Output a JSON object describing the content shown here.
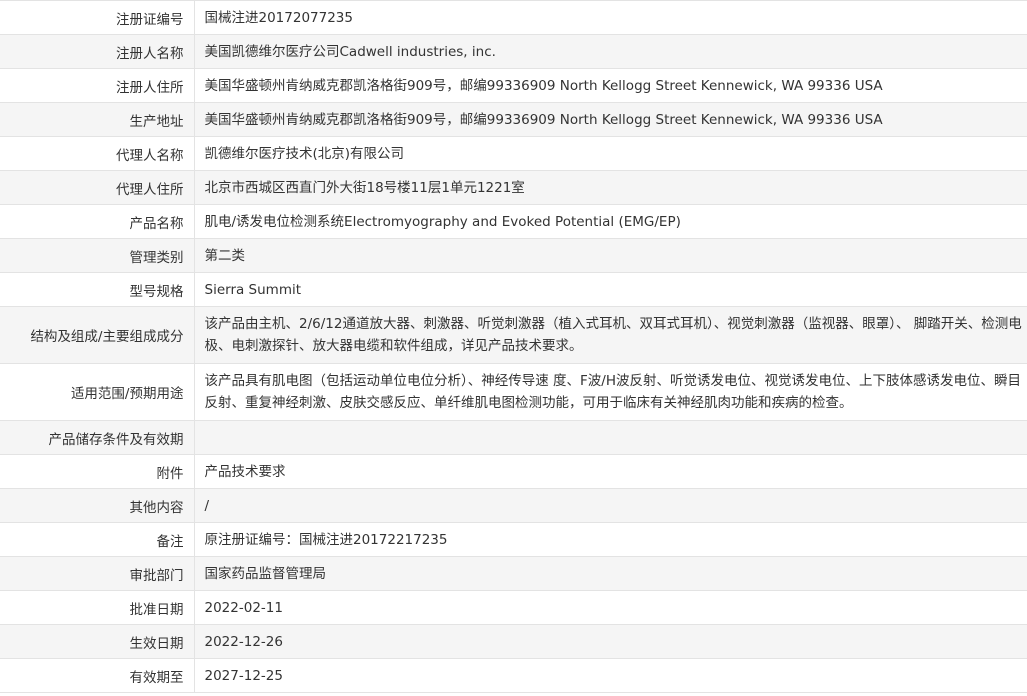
{
  "rows": [
    {
      "label": "注册证编号",
      "value": "国械注进20172077235"
    },
    {
      "label": "注册人名称",
      "value": "美国凯德维尔医疗公司Cadwell industries, inc."
    },
    {
      "label": "注册人住所",
      "value": "美国华盛顿州肯纳威克郡凯洛格街909号，邮编99336909 North Kellogg Street Kennewick, WA 99336 USA"
    },
    {
      "label": "生产地址",
      "value": "美国华盛顿州肯纳威克郡凯洛格街909号，邮编99336909 North Kellogg Street Kennewick, WA 99336 USA"
    },
    {
      "label": "代理人名称",
      "value": "凯德维尔医疗技术(北京)有限公司"
    },
    {
      "label": "代理人住所",
      "value": "北京市西城区西直门外大街18号楼11层1单元1221室"
    },
    {
      "label": "产品名称",
      "value": "肌电/诱发电位检测系统Electromyography and Evoked Potential (EMG/EP)"
    },
    {
      "label": "管理类别",
      "value": "第二类"
    },
    {
      "label": "型号规格",
      "value": "Sierra Summit"
    },
    {
      "label": "结构及组成/主要组成成分",
      "value": "该产品由主机、2/6/12通道放大器、刺激器、听觉刺激器（植入式耳机、双耳式耳机）、视觉刺激器（监视器、眼罩）、 脚踏开关、检测电极、电刺激探针、放大器电缆和软件组成，详见产品技术要求。"
    },
    {
      "label": "适用范围/预期用途",
      "value": "该产品具有肌电图（包括运动单位电位分析）、神经传导速 度、F波/H波反射、听觉诱发电位、视觉诱发电位、上下肢体感诱发电位、瞬目反射、重复神经刺激、皮肤交感反应、单纤维肌电图检测功能，可用于临床有关神经肌肉功能和疾病的检查。"
    },
    {
      "label": "产品储存条件及有效期",
      "value": ""
    },
    {
      "label": "附件",
      "value": "产品技术要求"
    },
    {
      "label": "其他内容",
      "value": "/"
    },
    {
      "label": "备注",
      "value": "原注册证编号：国械注进20172217235"
    },
    {
      "label": "审批部门",
      "value": "国家药品监督管理局"
    },
    {
      "label": "批准日期",
      "value": "2022-02-11"
    },
    {
      "label": "生效日期",
      "value": "2022-12-26"
    },
    {
      "label": "有效期至",
      "value": "2027-12-25"
    }
  ]
}
